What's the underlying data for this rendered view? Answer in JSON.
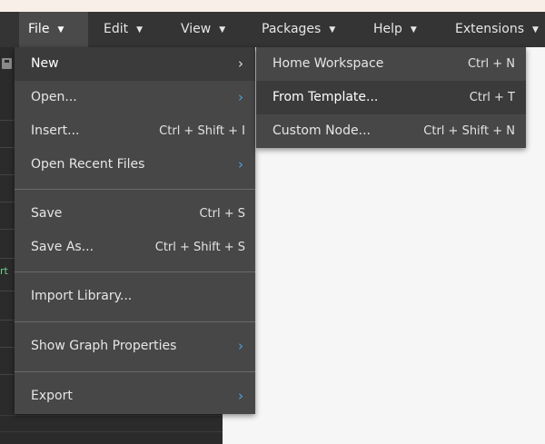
{
  "menubar": {
    "items": [
      {
        "label": "File",
        "arrow": "▼"
      },
      {
        "label": "Edit",
        "arrow": "▼"
      },
      {
        "label": "View",
        "arrow": "▼"
      },
      {
        "label": "Packages",
        "arrow": "▼"
      },
      {
        "label": "Help",
        "arrow": "▼"
      },
      {
        "label": "Extensions",
        "arrow": "▼"
      }
    ]
  },
  "left_panel": {
    "visible_text": "rt"
  },
  "file_menu": {
    "items": [
      {
        "label": "New",
        "shortcut": "",
        "submenu": "›"
      },
      {
        "label": "Open...",
        "shortcut": "",
        "submenu": "›"
      },
      {
        "label": "Insert...",
        "shortcut": "Ctrl + Shift + I",
        "submenu": ""
      },
      {
        "label": "Open Recent Files",
        "shortcut": "",
        "submenu": "›"
      },
      {
        "label": "Save",
        "shortcut": "Ctrl + S",
        "submenu": ""
      },
      {
        "label": "Save As...",
        "shortcut": "Ctrl + Shift + S",
        "submenu": ""
      },
      {
        "label": "Import Library...",
        "shortcut": "",
        "submenu": ""
      },
      {
        "label": "Show Graph Properties",
        "shortcut": "",
        "submenu": "›"
      },
      {
        "label": "Export",
        "shortcut": "",
        "submenu": "›"
      }
    ]
  },
  "new_submenu": {
    "items": [
      {
        "label": "Home Workspace",
        "shortcut": "Ctrl + N"
      },
      {
        "label": "From Template...",
        "shortcut": "Ctrl + T"
      },
      {
        "label": "Custom Node...",
        "shortcut": "Ctrl + Shift + N"
      }
    ]
  },
  "colors": {
    "menubar_bg": "#343434",
    "menu_bg": "#474747",
    "highlight_bg": "#3b3b3b",
    "submenu_arrow": "#4ea0d6",
    "canvas_bg": "#f6f6f6",
    "panel_bg": "#2b2b2b"
  }
}
